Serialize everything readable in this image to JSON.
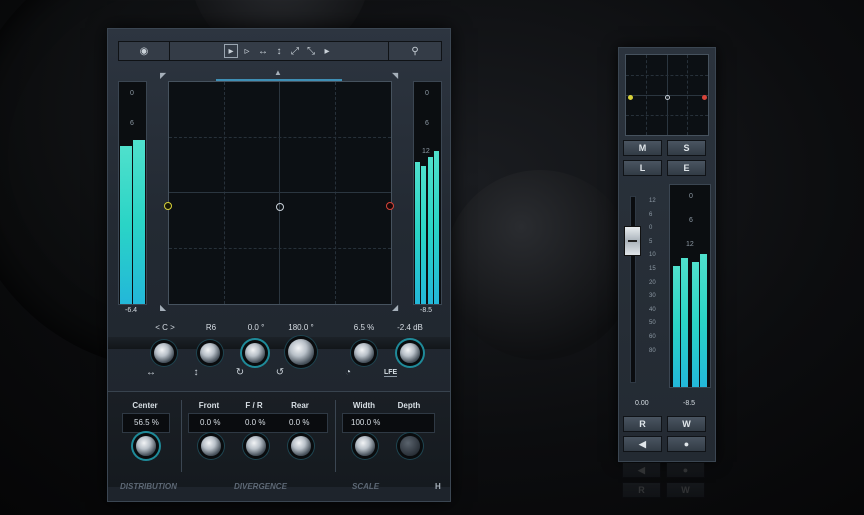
{
  "main": {
    "toolbar": {
      "tools": [
        "▸",
        "▹",
        "↔",
        "↕",
        "⤢",
        "⤡",
        "▸"
      ],
      "eye_icon": "eye-icon",
      "pin_icon": "pin-icon"
    },
    "left_meter": {
      "ticks": [
        "0",
        "6"
      ],
      "readout": "-6.4",
      "levels": [
        0.71,
        0.74
      ]
    },
    "right_meter": {
      "ticks": [
        "0",
        "6",
        "12"
      ],
      "readout": "-8.5",
      "levels": [
        0.64,
        0.62,
        0.66,
        0.69
      ]
    },
    "params": {
      "pan_label": "< C >",
      "mode_label": "R6",
      "rotation_value": "0.0 °",
      "angle_value": "180.0 °",
      "percent_value": "6.5 %",
      "lfe_value": "-2.4 dB",
      "lfe_label": "LFE"
    },
    "distribution": {
      "center_label": "Center",
      "center_value": "56.5 %"
    },
    "divergence": {
      "front_label": "Front",
      "fr_label": "F / R",
      "rear_label": "Rear",
      "front_value": "0.0 %",
      "fr_value": "0.0 %",
      "rear_value": "0.0 %"
    },
    "scale": {
      "width_label": "Width",
      "depth_label": "Depth",
      "width_value": "100.0 %"
    },
    "footer": {
      "distribution": "DISTRIBUTION",
      "divergence": "DIVERGENCE",
      "scale": "SCALE",
      "corner": "H"
    }
  },
  "channel": {
    "buttons": {
      "m": "M",
      "s": "S",
      "l": "L",
      "e": "E",
      "r": "R",
      "w": "W"
    },
    "fader_scale": [
      "12",
      "6",
      "0",
      "5",
      "10",
      "15",
      "20",
      "30",
      "40",
      "50",
      "60",
      "80"
    ],
    "meter_ticks": [
      "0",
      "6",
      "12"
    ],
    "fader_value": "0.00",
    "meter_value": "-8.5",
    "meter_levels": [
      0.6,
      0.64,
      0.62,
      0.66
    ]
  },
  "colors": {
    "meter_top": "#4fe0cc",
    "meter_bottom": "#23b7d9",
    "left_dot": "#d8d23a",
    "right_dot": "#d8443a"
  }
}
